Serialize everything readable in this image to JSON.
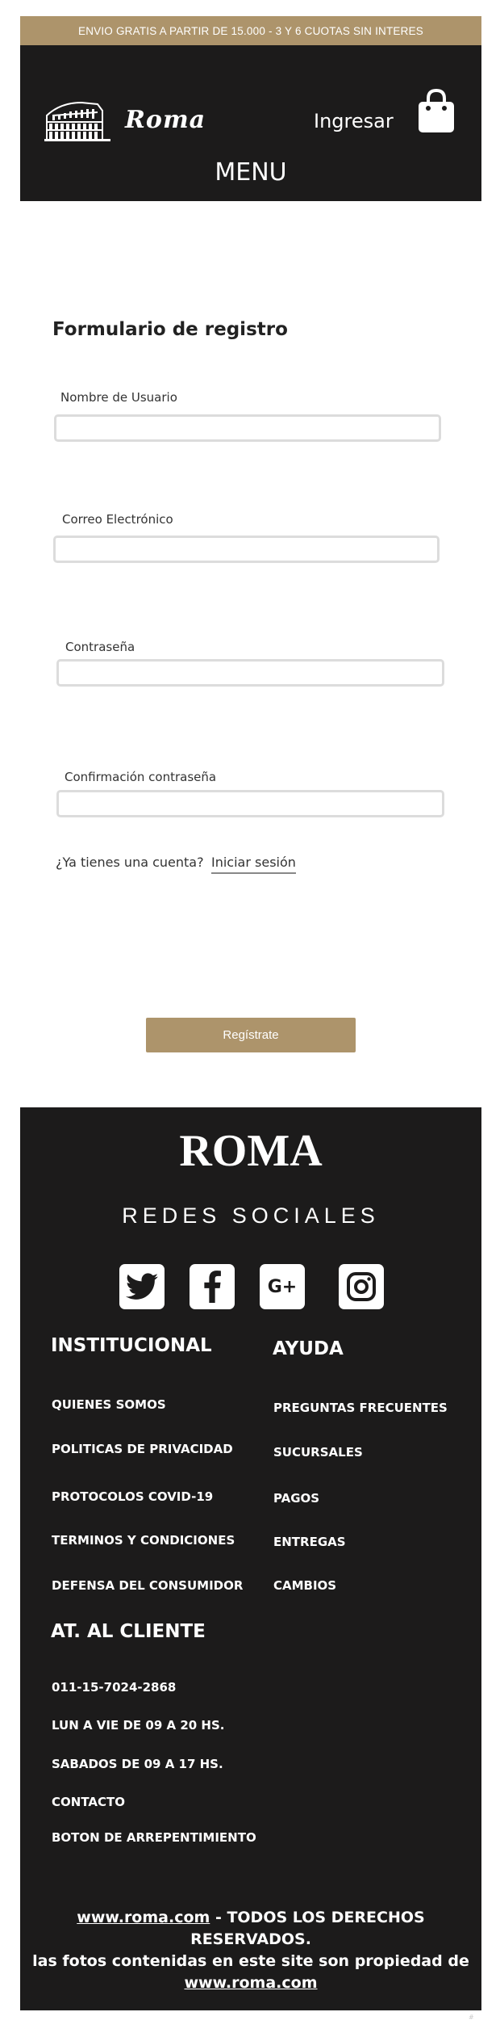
{
  "promo": {
    "text": "ENVIO GRATIS A PARTIR DE 15.000 - 3 Y 6 CUOTAS SIN INTERES"
  },
  "header": {
    "logo_text": "Roma",
    "login_label": "Ingresar",
    "menu_label": "MENU",
    "logo_icon": "colosseum-icon",
    "cart_icon": "shopping-bag-icon"
  },
  "form": {
    "title": "Formulario de registro",
    "fields": [
      {
        "label": "Nombre de Usuario",
        "value": "",
        "placeholder": ""
      },
      {
        "label": "Correo Electrónico",
        "value": "",
        "placeholder": ""
      },
      {
        "label": "Contraseña",
        "value": "",
        "placeholder": ""
      },
      {
        "label": "Confirmación contraseña",
        "value": "",
        "placeholder": ""
      }
    ],
    "login_question": "¿Ya tienes una cuenta?",
    "login_link": "Iniciar sesión",
    "submit_label": "Regístrate"
  },
  "footer": {
    "brand": "ROMA",
    "social_heading": "REDES SOCIALES",
    "social_icons": [
      "twitter-icon",
      "facebook-icon",
      "google-plus-icon",
      "instagram-icon"
    ],
    "institutional": {
      "heading": "INSTITUCIONAL",
      "links": [
        "QUIENES SOMOS",
        "POLITICAS DE PRIVACIDAD",
        "PROTOCOLOS COVID-19",
        "TERMINOS Y CONDICIONES",
        "DEFENSA DEL CONSUMIDOR"
      ]
    },
    "help": {
      "heading": "AYUDA",
      "links": [
        "PREGUNTAS FRECUENTES",
        "SUCURSALES",
        "PAGOS",
        "ENTREGAS",
        "CAMBIOS"
      ]
    },
    "customer": {
      "heading": "AT. AL CLIENTE",
      "items": [
        "011-15-7024-2868",
        "LUN A VIE DE 09 A 20 HS.",
        "SABADOS DE 09 A 17 HS.",
        "CONTACTO",
        "BOTON DE ARREPENTIMIENTO"
      ]
    },
    "copyright": {
      "site": "www.roma.com",
      "line1_rest": " - TODOS LOS DERECHOS RESERVADOS.",
      "line2": "las fotos contenidas en este site son propiedad de",
      "site2": "www.roma.com"
    }
  },
  "watermark": "#"
}
